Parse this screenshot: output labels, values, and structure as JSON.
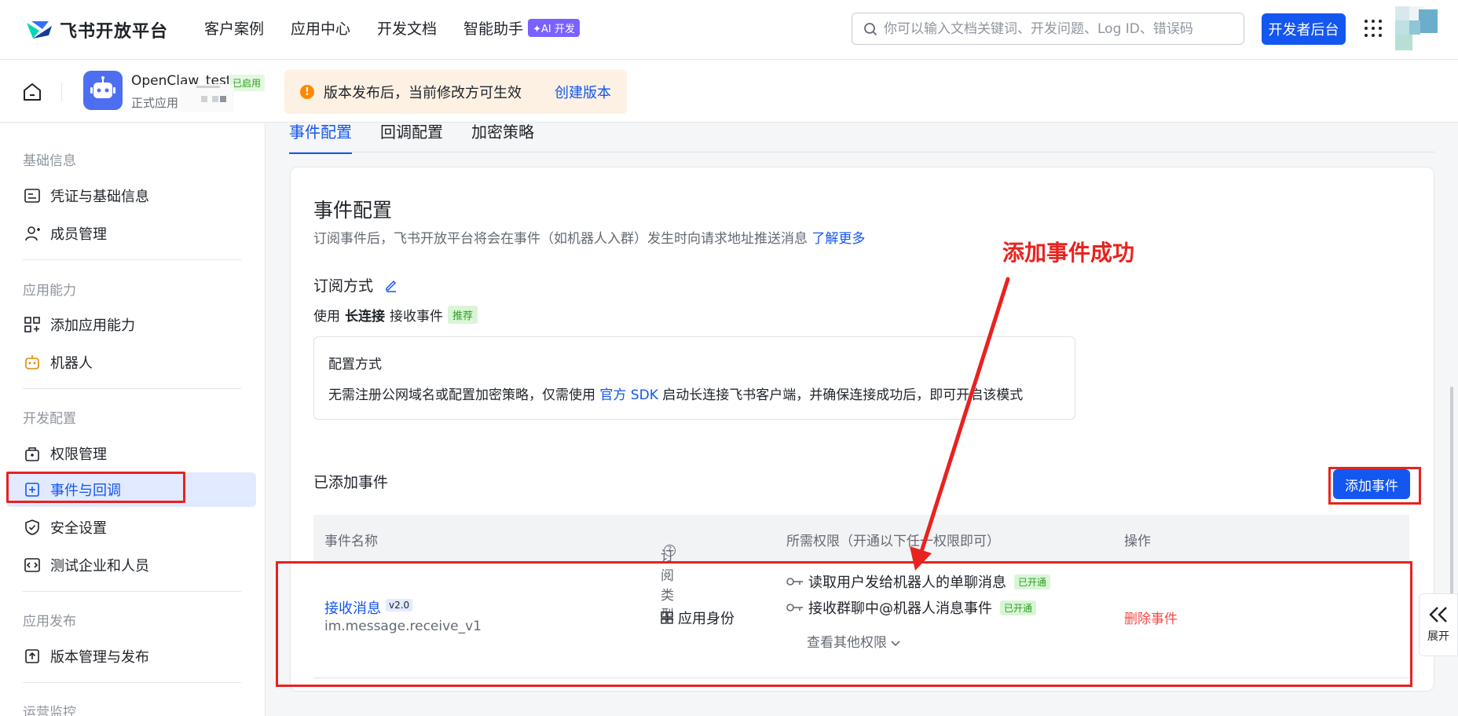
{
  "topnav": {
    "brand": "飞书开放平台",
    "links": [
      "客户案例",
      "应用中心",
      "开发文档",
      "智能助手"
    ],
    "ai_badge": "✦AI 开发",
    "search_placeholder": "你可以输入文档关键词、开发问题、Log ID、错误码",
    "dev_console": "开发者后台"
  },
  "app": {
    "name": "OpenClaw_test",
    "status": "已启用",
    "type": "正式应用",
    "notice": "版本发布后，当前修改方可生效",
    "create_version": "创建版本"
  },
  "sidebar": {
    "groups": [
      {
        "title": "基础信息",
        "items": [
          "凭证与基础信息",
          "成员管理"
        ]
      },
      {
        "title": "应用能力",
        "items": [
          "添加应用能力",
          "机器人"
        ]
      },
      {
        "title": "开发配置",
        "items": [
          "权限管理",
          "事件与回调",
          "安全设置",
          "测试企业和人员"
        ]
      },
      {
        "title": "应用发布",
        "items": [
          "版本管理与发布"
        ]
      },
      {
        "title": "运营监控",
        "items": []
      }
    ],
    "active": "事件与回调"
  },
  "tabs": [
    "事件配置",
    "回调配置",
    "加密策略"
  ],
  "active_tab": "事件配置",
  "card": {
    "title": "事件配置",
    "desc": "订阅事件后，飞书开放平台将会在事件（如机器人入群）发生时向请求地址推送消息",
    "learn_more": "了解更多",
    "sub_mode_label": "订阅方式",
    "use_prefix": "使用",
    "use_bold": "长连接",
    "use_suffix": "接收事件",
    "recommend_tag": "推荐",
    "config_title": "配置方式",
    "config_desc_1": "无需注册公网域名或配置加密策略，仅需使用",
    "config_sdk": "官方 SDK",
    "config_desc_2": "启动长连接飞书客户端，并确保连接成功后，即可开启该模式"
  },
  "events": {
    "title": "已添加事件",
    "add_button": "添加事件",
    "columns": [
      "事件名称",
      "订阅类型",
      "所需权限（开通以下任一权限即可）",
      "操作"
    ],
    "rows": [
      {
        "name": "接收消息",
        "version": "v2.0",
        "key": "im.message.receive_v1",
        "sub_type": "应用身份",
        "permissions": [
          {
            "label": "读取用户发给机器人的单聊消息",
            "status": "已开通"
          },
          {
            "label": "接收群聊中@机器人消息事件",
            "status": "已开通"
          }
        ],
        "more_permissions": "查看其他权限",
        "action": "删除事件"
      }
    ]
  },
  "annotation": "添加事件成功",
  "expand_label": "展开",
  "colors": {
    "primary": "#1456f0",
    "danger": "#f54a45",
    "highlight": "#e8221f",
    "success": "#2ea121"
  }
}
